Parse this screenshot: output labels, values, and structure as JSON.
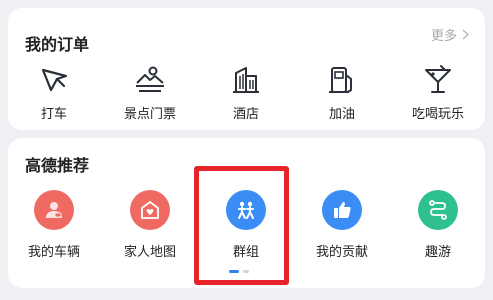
{
  "orders": {
    "title": "我的订单",
    "more_label": "更多",
    "items": [
      {
        "label": "打车",
        "icon": "taxi-arrow-icon"
      },
      {
        "label": "景点门票",
        "icon": "scenic-ticket-icon"
      },
      {
        "label": "酒店",
        "icon": "hotel-icon"
      },
      {
        "label": "加油",
        "icon": "gas-pump-icon"
      },
      {
        "label": "吃喝玩乐",
        "icon": "cocktail-icon"
      }
    ]
  },
  "recommend": {
    "title": "高德推荐",
    "items": [
      {
        "label": "我的车辆",
        "icon": "car-user-icon",
        "color": "#ef6a63"
      },
      {
        "label": "家人地图",
        "icon": "family-heart-icon",
        "color": "#ef6a63"
      },
      {
        "label": "群组",
        "icon": "group-icon",
        "color": "#3b8cf4"
      },
      {
        "label": "我的贡献",
        "icon": "thumbs-up-icon",
        "color": "#3b8cf4"
      },
      {
        "label": "趣游",
        "icon": "route-icon",
        "color": "#2fc08f"
      }
    ]
  },
  "colors": {
    "accent_red": "#e8242b",
    "accent_blue": "#2d80ff",
    "background": "#eef0f3"
  }
}
